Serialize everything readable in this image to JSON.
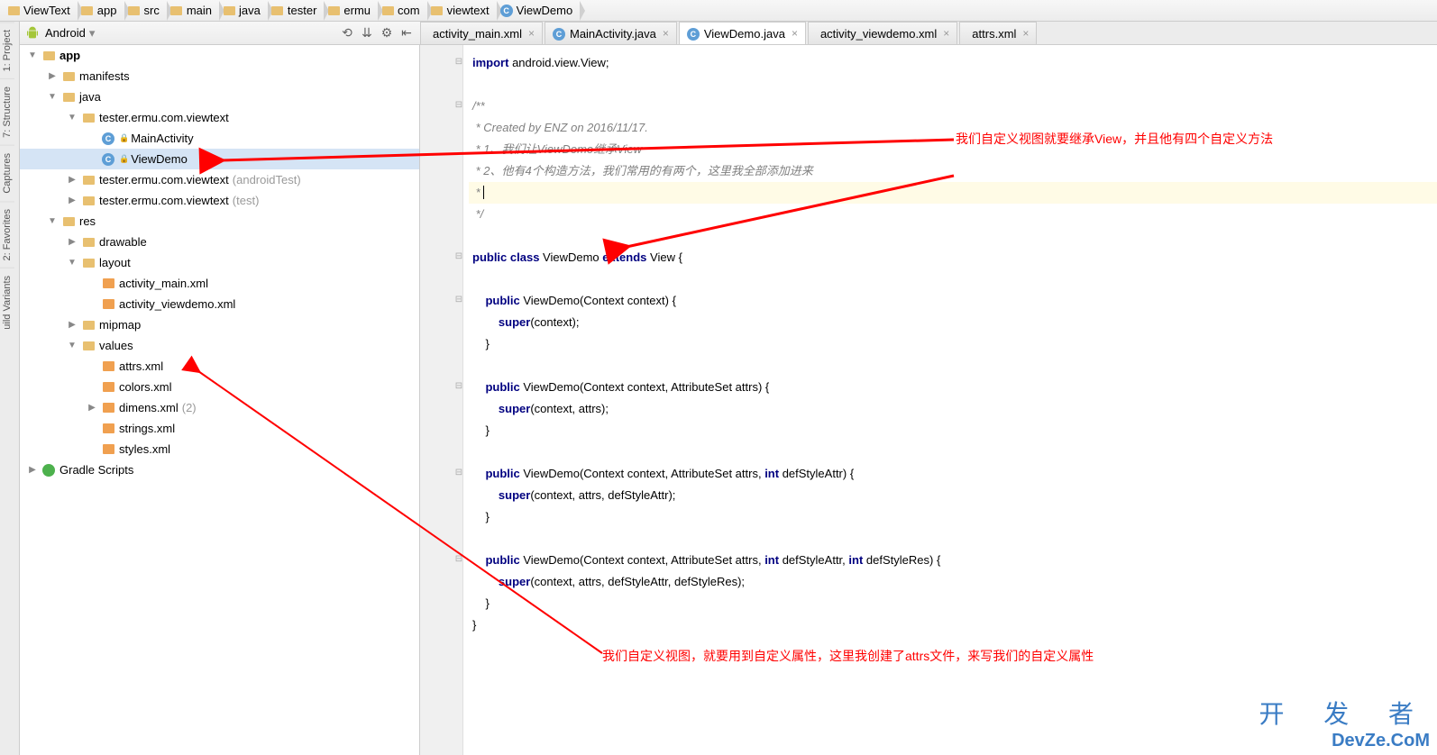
{
  "breadcrumb": [
    {
      "label": "ViewText",
      "icon": "folder"
    },
    {
      "label": "app",
      "icon": "folder"
    },
    {
      "label": "src",
      "icon": "folder"
    },
    {
      "label": "main",
      "icon": "folder"
    },
    {
      "label": "java",
      "icon": "folder"
    },
    {
      "label": "tester",
      "icon": "folder"
    },
    {
      "label": "ermu",
      "icon": "folder"
    },
    {
      "label": "com",
      "icon": "folder"
    },
    {
      "label": "viewtext",
      "icon": "folder"
    },
    {
      "label": "ViewDemo",
      "icon": "class"
    }
  ],
  "leftTools": [
    "1: Project",
    "7: Structure",
    "Captures",
    "2: Favorites",
    "uild Variants"
  ],
  "projHeader": {
    "mode": "Android"
  },
  "tree": [
    {
      "d": 0,
      "a": "▼",
      "ico": "folder",
      "nm": "app",
      "bold": true
    },
    {
      "d": 1,
      "a": "▶",
      "ico": "folder",
      "nm": "manifests"
    },
    {
      "d": 1,
      "a": "▼",
      "ico": "folder",
      "nm": "java"
    },
    {
      "d": 2,
      "a": "▼",
      "ico": "folder",
      "nm": "tester.ermu.com.viewtext"
    },
    {
      "d": 3,
      "a": "",
      "ico": "class",
      "lock": true,
      "nm": "MainActivity"
    },
    {
      "d": 3,
      "a": "",
      "ico": "class",
      "lock": true,
      "nm": "ViewDemo",
      "sel": true
    },
    {
      "d": 2,
      "a": "▶",
      "ico": "folder",
      "nm": "tester.ermu.com.viewtext",
      "suffix": "(androidTest)"
    },
    {
      "d": 2,
      "a": "▶",
      "ico": "folder",
      "nm": "tester.ermu.com.viewtext",
      "suffix": "(test)"
    },
    {
      "d": 1,
      "a": "▼",
      "ico": "folder",
      "nm": "res"
    },
    {
      "d": 2,
      "a": "▶",
      "ico": "folder",
      "nm": "drawable"
    },
    {
      "d": 2,
      "a": "▼",
      "ico": "folder",
      "nm": "layout"
    },
    {
      "d": 3,
      "a": "",
      "ico": "xml",
      "nm": "activity_main.xml"
    },
    {
      "d": 3,
      "a": "",
      "ico": "xml",
      "nm": "activity_viewdemo.xml"
    },
    {
      "d": 2,
      "a": "▶",
      "ico": "folder",
      "nm": "mipmap"
    },
    {
      "d": 2,
      "a": "▼",
      "ico": "folder",
      "nm": "values"
    },
    {
      "d": 3,
      "a": "",
      "ico": "xml",
      "nm": "attrs.xml"
    },
    {
      "d": 3,
      "a": "",
      "ico": "xml",
      "nm": "colors.xml"
    },
    {
      "d": 3,
      "a": "▶",
      "ico": "xml",
      "nm": "dimens.xml",
      "suffix": "(2)"
    },
    {
      "d": 3,
      "a": "",
      "ico": "xml",
      "nm": "strings.xml"
    },
    {
      "d": 3,
      "a": "",
      "ico": "xml",
      "nm": "styles.xml"
    },
    {
      "d": 0,
      "a": "▶",
      "ico": "gradle",
      "nm": "Gradle Scripts"
    }
  ],
  "etabs": [
    {
      "label": "activity_main.xml",
      "ico": "xml"
    },
    {
      "label": "MainActivity.java",
      "ico": "class"
    },
    {
      "label": "ViewDemo.java",
      "ico": "class",
      "active": true
    },
    {
      "label": "activity_viewdemo.xml",
      "ico": "xml"
    },
    {
      "label": "attrs.xml",
      "ico": "xml"
    }
  ],
  "code": [
    {
      "html": "<span class='kw'>import</span> android.view.View;"
    },
    {
      "html": ""
    },
    {
      "html": "<span class='cm'>/**</span>"
    },
    {
      "html": "<span class='cm'> * Created by ENZ on 2016/11/17.</span>"
    },
    {
      "html": "<span class='cm'> * 1、我们让ViewDemo继承View</span>"
    },
    {
      "html": "<span class='cm'> * 2、他有4个构造方法，我们常用的有两个，这里我全部添加进来</span>"
    },
    {
      "html": "<span class='cm'> *</span> <span style='border-left:1px solid #000;height:16px;'></span>",
      "hl": true
    },
    {
      "html": "<span class='cm'> */</span>"
    },
    {
      "html": ""
    },
    {
      "html": "<span class='kw'>public class</span> ViewDemo <span class='kw'>extends</span> View {"
    },
    {
      "html": ""
    },
    {
      "html": "    <span class='kw'>public</span> ViewDemo(Context context) {"
    },
    {
      "html": "        <span class='kw'>super</span>(context);"
    },
    {
      "html": "    }"
    },
    {
      "html": ""
    },
    {
      "html": "    <span class='kw'>public</span> ViewDemo(Context context, AttributeSet attrs) {"
    },
    {
      "html": "        <span class='kw'>super</span>(context, attrs);"
    },
    {
      "html": "    }"
    },
    {
      "html": ""
    },
    {
      "html": "    <span class='kw'>public</span> ViewDemo(Context context, AttributeSet attrs, <span class='kw'>int</span> defStyleAttr) {"
    },
    {
      "html": "        <span class='kw'>super</span>(context, attrs, defStyleAttr);"
    },
    {
      "html": "    }"
    },
    {
      "html": ""
    },
    {
      "html": "    <span class='kw'>public</span> ViewDemo(Context context, AttributeSet attrs, <span class='kw'>int</span> defStyleAttr, <span class='kw'>int</span> defStyleRes) {"
    },
    {
      "html": "        <span class='kw'>super</span>(context, attrs, defStyleAttr, defStyleRes);"
    },
    {
      "html": "    }"
    },
    {
      "html": "}"
    }
  ],
  "annotations": {
    "a1": "我们自定义视图就要继承View，并且他有四个自定义方法",
    "a2": "我们自定义视图，就要用到自定义属性，这里我创建了attrs文件，来写我们的自定义属性"
  },
  "watermark": {
    "t1": "开 发 者",
    "t2": "DevZe.CoM"
  }
}
